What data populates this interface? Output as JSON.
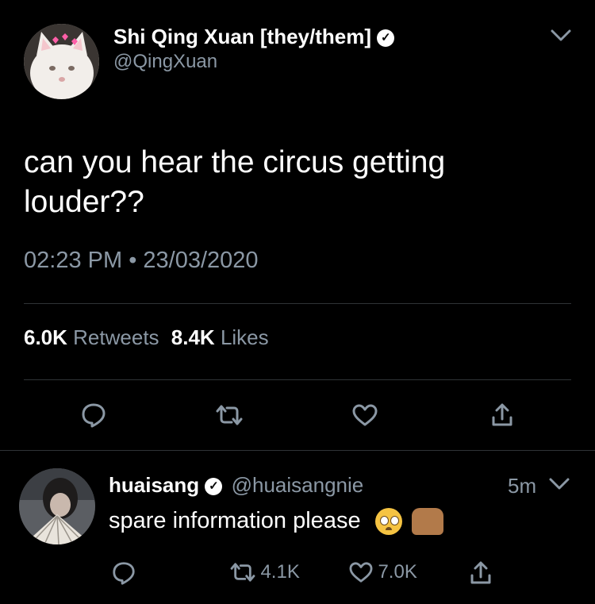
{
  "main_tweet": {
    "display_name": "Shi Qing Xuan [they/them]",
    "handle": "@QingXuan",
    "text": "can you hear the circus getting louder??",
    "time": "02:23 PM",
    "separator": "•",
    "date": "23/03/2020",
    "retweets_count": "6.0K",
    "retweets_label": "Retweets",
    "likes_count": "8.4K",
    "likes_label": "Likes",
    "icons": [
      "chevron-down-icon",
      "reply-icon",
      "retweet-icon",
      "like-icon",
      "share-icon",
      "verified-icon"
    ]
  },
  "reply_tweet": {
    "display_name": "huaisang",
    "handle": "@huaisangnie",
    "age": "5m",
    "text": "spare information please",
    "emojis": [
      "pleading-face-emoji",
      "raised-hands-emoji"
    ],
    "retweet_count": "4.1K",
    "like_count": "7.0K",
    "icons": [
      "chevron-down-icon",
      "reply-icon",
      "retweet-icon",
      "like-icon",
      "share-icon",
      "verified-icon"
    ]
  },
  "colors": {
    "background": "#000000",
    "text": "#e7e9ea",
    "muted": "#8b98a5",
    "divider": "#2f3336"
  }
}
